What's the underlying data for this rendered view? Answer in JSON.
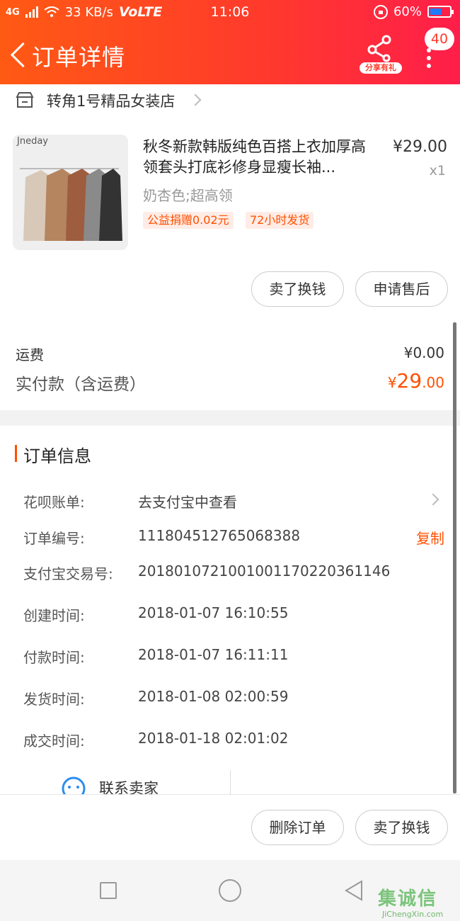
{
  "status_bar": {
    "signal": "4G",
    "speed": "33 KB/s",
    "volte": "VoLTE",
    "time": "11:06",
    "battery": "60%",
    "battery_level": 0.6,
    "battery_color": "#1e7bff"
  },
  "header": {
    "back_icon": "chevron-left-icon",
    "title": "订单详情",
    "share_label": "分享有礼",
    "badge_count": "40"
  },
  "shop": {
    "name": "转角1号精品女装店"
  },
  "product": {
    "image_caption": "Jneday",
    "title": "秋冬新款韩版纯色百搭上衣加厚高领套头打底衫修身显瘦长袖...",
    "price": "¥29.00",
    "quantity": "x1",
    "sku": "奶杏色;超高领",
    "tags": [
      "公益捐赠0.02元",
      "72小时发货"
    ],
    "actions": [
      "卖了换钱",
      "申请售后"
    ]
  },
  "payment": {
    "shipping_label": "运费",
    "shipping_value": "¥0.00",
    "total_label": "实付款（含运费）",
    "total_currency": "¥",
    "total_int": "29",
    "total_dec": ".00",
    "accent_color": "#ff5000"
  },
  "order_info": {
    "title": "订单信息",
    "rows": [
      {
        "label": "花呗账单:",
        "value": "去支付宝中查看"
      },
      {
        "label": "订单编号:",
        "value": "111804512765068388",
        "action": "复制"
      },
      {
        "label": "支付宝交易号:",
        "value": "2018010721001001170220361146"
      },
      {
        "label": "创建时间:",
        "value": "2018-01-07 16:10:55"
      },
      {
        "label": "付款时间:",
        "value": "2018-01-07 16:11:11"
      },
      {
        "label": "发货时间:",
        "value": "2018-01-08 02:00:59"
      },
      {
        "label": "成交时间:",
        "value": "2018-01-18 02:01:02"
      }
    ],
    "contact_label": "联系卖家"
  },
  "bottom_actions": [
    "删除订单",
    "卖了换钱"
  ],
  "watermark": {
    "main": "集诚信",
    "sub": "JiChengXin.com"
  }
}
